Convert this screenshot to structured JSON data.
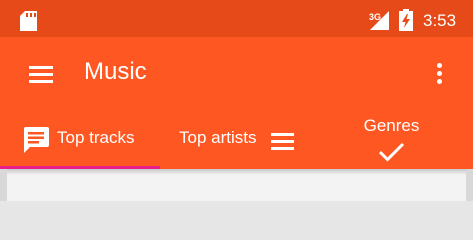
{
  "status_bar": {
    "network_label": "3G",
    "time": "3:53",
    "icons": [
      "sd-card-icon",
      "signal-icon",
      "battery-charging-icon"
    ]
  },
  "app_bar": {
    "title": "Music",
    "menu_icon": "hamburger-menu-icon",
    "overflow_icon": "more-vert-icon",
    "colors": {
      "status": "#e64a19",
      "primary": "#ff5722",
      "indicator": "#e91e8a"
    }
  },
  "tabs": [
    {
      "label": "Top tracks",
      "icon": "chat-bubble-icon",
      "selected": true
    },
    {
      "label": "Top artists",
      "icon": "list-icon",
      "selected": false
    },
    {
      "label": "Genres",
      "icon": "check-icon",
      "selected": false
    }
  ]
}
